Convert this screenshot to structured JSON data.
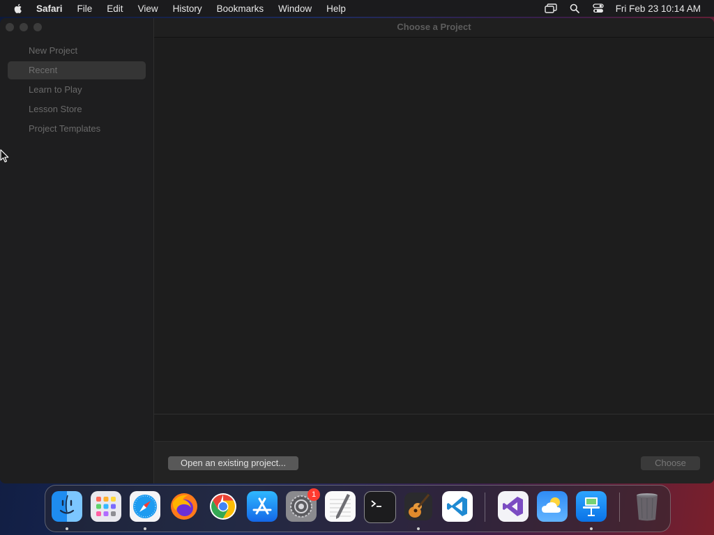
{
  "menubar": {
    "app_name": "Safari",
    "items": [
      "File",
      "Edit",
      "View",
      "History",
      "Bookmarks",
      "Window",
      "Help"
    ],
    "clock": "Fri Feb 23  10:14 AM"
  },
  "window": {
    "title": "Choose a Project",
    "sidebar": {
      "items": [
        {
          "label": "New Project"
        },
        {
          "label": "Recent"
        },
        {
          "label": "Learn to Play"
        },
        {
          "label": "Lesson Store"
        },
        {
          "label": "Project Templates"
        }
      ],
      "selected_item": "Recent"
    },
    "footer": {
      "open_label": "Open an existing project...",
      "choose_label": "Choose"
    }
  },
  "dock": {
    "apps": [
      {
        "name": "finder",
        "running": true
      },
      {
        "name": "launchpad",
        "running": false
      },
      {
        "name": "safari",
        "running": true
      },
      {
        "name": "firefox",
        "running": false
      },
      {
        "name": "chrome",
        "running": false
      },
      {
        "name": "app-store",
        "running": false
      },
      {
        "name": "system-settings",
        "running": false,
        "badge": "1"
      },
      {
        "name": "textedit",
        "running": false
      },
      {
        "name": "terminal",
        "running": false
      },
      {
        "name": "garageband",
        "running": true
      },
      {
        "name": "vscode",
        "running": false
      },
      {
        "name": "visual-studio",
        "running": false
      },
      {
        "name": "weather",
        "running": false
      },
      {
        "name": "keynote",
        "running": true
      },
      {
        "name": "trash",
        "running": false
      }
    ]
  },
  "colors": {
    "menubar_bg": "#1b1b1d",
    "window_bg": "#1e1e1e",
    "selected_bg": "#353535",
    "badge": "#ff3b30"
  }
}
